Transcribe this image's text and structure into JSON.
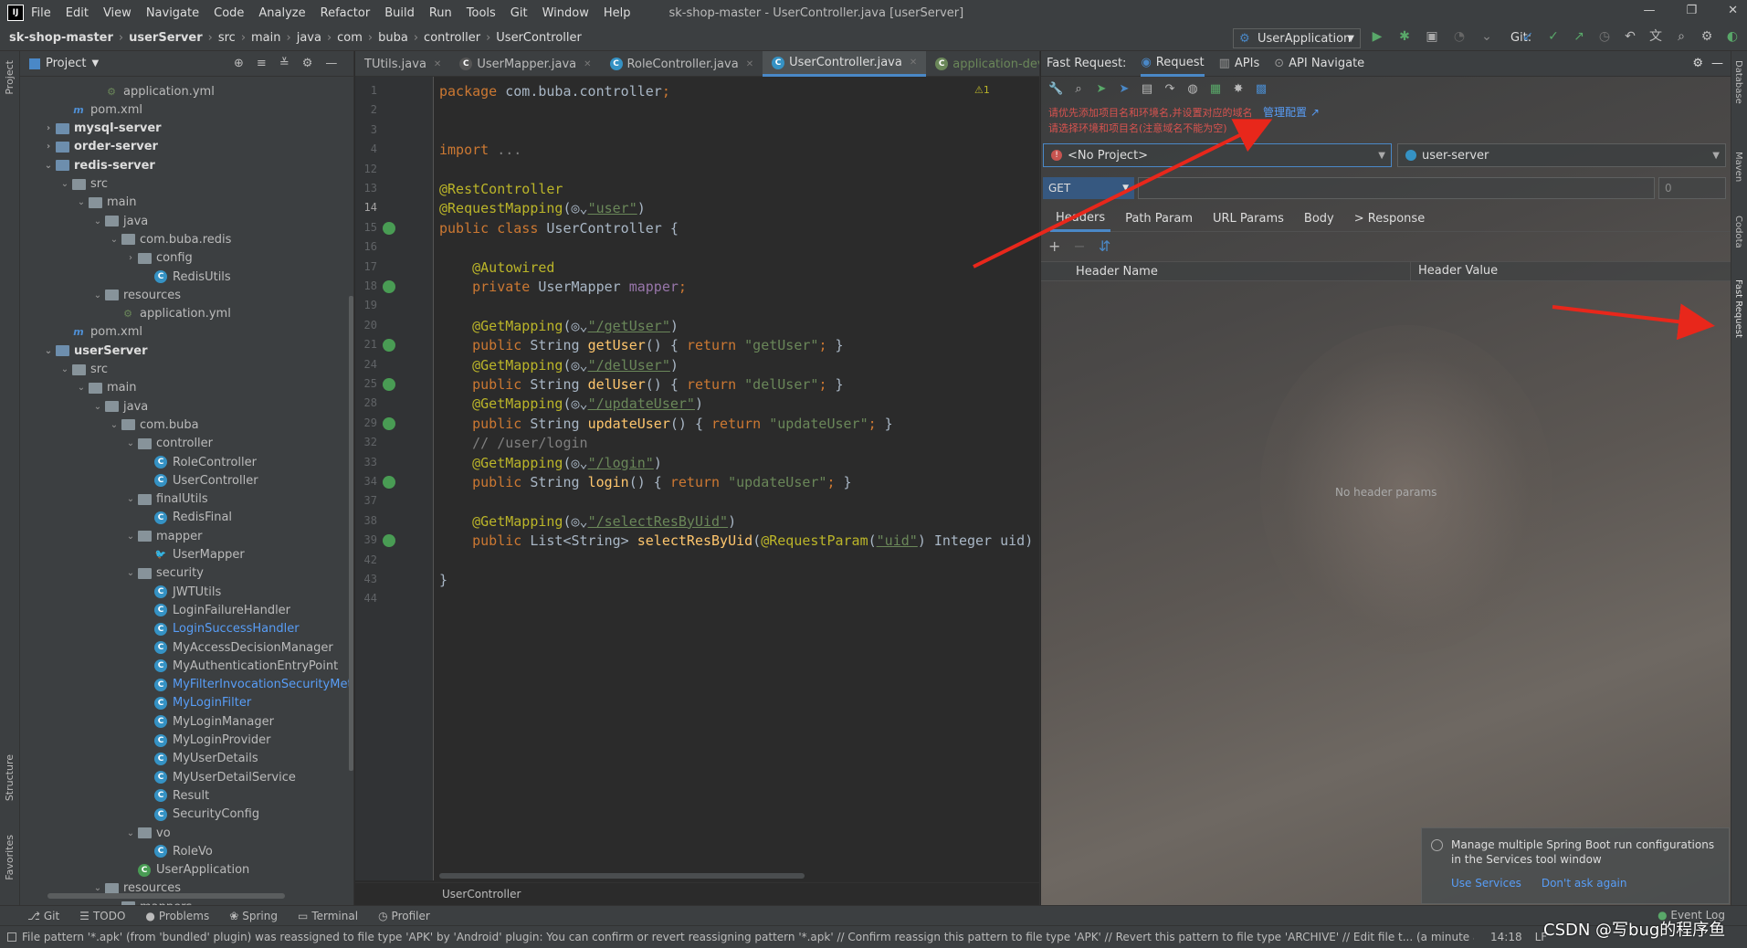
{
  "menu": {
    "items": [
      "File",
      "Edit",
      "View",
      "Navigate",
      "Code",
      "Analyze",
      "Refactor",
      "Build",
      "Run",
      "Tools",
      "Git",
      "Window",
      "Help"
    ],
    "window_title": "sk-shop-master - UserController.java [userServer]"
  },
  "breadcrumb": [
    "sk-shop-master",
    "userServer",
    "src",
    "main",
    "java",
    "com",
    "buba",
    "controller",
    "UserController"
  ],
  "run_config": "UserApplication",
  "git_label": "Git:",
  "project_panel": {
    "title": "Project",
    "tree": [
      {
        "label": "application.yml",
        "type": "yml",
        "depth": 4
      },
      {
        "label": "pom.xml",
        "type": "maven",
        "depth": 2
      },
      {
        "label": "mysql-server",
        "type": "module",
        "depth": 1,
        "arrow": "›",
        "bold": true
      },
      {
        "label": "order-server",
        "type": "module",
        "depth": 1,
        "arrow": "›",
        "bold": true
      },
      {
        "label": "redis-server",
        "type": "module",
        "depth": 1,
        "arrow": "⌄",
        "bold": true
      },
      {
        "label": "src",
        "type": "folder",
        "depth": 2,
        "arrow": "⌄"
      },
      {
        "label": "main",
        "type": "folder",
        "depth": 3,
        "arrow": "⌄"
      },
      {
        "label": "java",
        "type": "folder",
        "depth": 4,
        "arrow": "⌄"
      },
      {
        "label": "com.buba.redis",
        "type": "folder",
        "depth": 5,
        "arrow": "⌄"
      },
      {
        "label": "config",
        "type": "folder",
        "depth": 6,
        "arrow": "›"
      },
      {
        "label": "RedisUtils",
        "type": "class",
        "depth": 7
      },
      {
        "label": "resources",
        "type": "folder",
        "depth": 4,
        "arrow": "⌄"
      },
      {
        "label": "application.yml",
        "type": "yml",
        "depth": 5
      },
      {
        "label": "pom.xml",
        "type": "maven",
        "depth": 2
      },
      {
        "label": "userServer",
        "type": "module",
        "depth": 1,
        "arrow": "⌄",
        "bold": true
      },
      {
        "label": "src",
        "type": "folder",
        "depth": 2,
        "arrow": "⌄"
      },
      {
        "label": "main",
        "type": "folder",
        "depth": 3,
        "arrow": "⌄"
      },
      {
        "label": "java",
        "type": "folder",
        "depth": 4,
        "arrow": "⌄"
      },
      {
        "label": "com.buba",
        "type": "folder",
        "depth": 5,
        "arrow": "⌄"
      },
      {
        "label": "controller",
        "type": "folder",
        "depth": 6,
        "arrow": "⌄"
      },
      {
        "label": "RoleController",
        "type": "class",
        "depth": 7
      },
      {
        "label": "UserController",
        "type": "class",
        "depth": 7
      },
      {
        "label": "finalUtils",
        "type": "folder",
        "depth": 6,
        "arrow": "⌄"
      },
      {
        "label": "RedisFinal",
        "type": "class",
        "depth": 7
      },
      {
        "label": "mapper",
        "type": "folder",
        "depth": 6,
        "arrow": "⌄"
      },
      {
        "label": "UserMapper",
        "type": "mapper",
        "depth": 7
      },
      {
        "label": "security",
        "type": "folder",
        "depth": 6,
        "arrow": "⌄"
      },
      {
        "label": "JWTUtils",
        "type": "class",
        "depth": 7
      },
      {
        "label": "LoginFailureHandler",
        "type": "class",
        "depth": 7
      },
      {
        "label": "LoginSuccessHandler",
        "type": "class",
        "depth": 7,
        "blue": true
      },
      {
        "label": "MyAccessDecisionManager",
        "type": "class",
        "depth": 7
      },
      {
        "label": "MyAuthenticationEntryPoint",
        "type": "class",
        "depth": 7
      },
      {
        "label": "MyFilterInvocationSecurityMeta",
        "type": "class",
        "depth": 7,
        "blue": true
      },
      {
        "label": "MyLoginFilter",
        "type": "class",
        "depth": 7,
        "blue": true
      },
      {
        "label": "MyLoginManager",
        "type": "class",
        "depth": 7
      },
      {
        "label": "MyLoginProvider",
        "type": "class",
        "depth": 7
      },
      {
        "label": "MyUserDetails",
        "type": "class",
        "depth": 7
      },
      {
        "label": "MyUserDetailService",
        "type": "class",
        "depth": 7
      },
      {
        "label": "Result",
        "type": "class",
        "depth": 7
      },
      {
        "label": "SecurityConfig",
        "type": "class",
        "depth": 7
      },
      {
        "label": "vo",
        "type": "folder",
        "depth": 6,
        "arrow": "⌄"
      },
      {
        "label": "RoleVo",
        "type": "class",
        "depth": 7
      },
      {
        "label": "UserApplication",
        "type": "app",
        "depth": 6
      },
      {
        "label": "resources",
        "type": "folder",
        "depth": 4,
        "arrow": "⌄"
      },
      {
        "label": "mappers",
        "type": "folder",
        "depth": 5,
        "arrow": "⌄"
      }
    ]
  },
  "editor": {
    "tabs": [
      {
        "label": "TUtils.java",
        "active": false
      },
      {
        "label": "UserMapper.java",
        "active": false
      },
      {
        "label": "RoleController.java",
        "active": false
      },
      {
        "label": "UserController.java",
        "active": true
      },
      {
        "label": "application-dev.yml",
        "active": false
      }
    ],
    "warning_count": "⚠1",
    "line_numbers": [
      "1",
      "2",
      "3",
      "4",
      "12",
      "13",
      "14",
      "15",
      "16",
      "17",
      "18",
      "19",
      "20",
      "21",
      "24",
      "25",
      "28",
      "29",
      "32",
      "33",
      "34",
      "37",
      "38",
      "39",
      "42",
      "43",
      "44"
    ],
    "lines": [
      [
        [
          "kw",
          "package "
        ],
        [
          "",
          "com.buba.controller"
        ],
        [
          "kw",
          ";"
        ]
      ],
      [],
      [],
      [
        [
          "kw",
          "import "
        ],
        [
          "cmt",
          "..."
        ]
      ],
      [],
      [
        [
          "ann",
          "@RestController"
        ]
      ],
      [
        [
          "ann",
          "@RequestMapping"
        ],
        [
          "",
          "(◎⌄"
        ],
        [
          "strl",
          "\"user\""
        ],
        [
          "",
          ")"
        ]
      ],
      [
        [
          "kw",
          "public class "
        ],
        [
          "",
          "UserController {"
        ]
      ],
      [],
      [
        [
          "ann",
          "    @Autowired"
        ]
      ],
      [
        [
          "kw",
          "    private "
        ],
        [
          "",
          "UserMapper "
        ],
        [
          "fld",
          "mapper"
        ],
        [
          "kw",
          ";"
        ]
      ],
      [],
      [
        [
          "ann",
          "    @GetMapping"
        ],
        [
          "",
          "(◎⌄"
        ],
        [
          "strl",
          "\"/getUser\""
        ],
        [
          "",
          ")"
        ]
      ],
      [
        [
          "kw",
          "    public "
        ],
        [
          "",
          "String "
        ],
        [
          "fn",
          "getUser"
        ],
        [
          "",
          "() { "
        ],
        [
          "kw",
          "return "
        ],
        [
          "str",
          "\"getUser\""
        ],
        [
          "kw",
          ";"
        ],
        [
          "",
          " }"
        ]
      ],
      [
        [
          "ann",
          "    @GetMapping"
        ],
        [
          "",
          "(◎⌄"
        ],
        [
          "strl",
          "\"/delUser\""
        ],
        [
          "",
          ")"
        ]
      ],
      [
        [
          "kw",
          "    public "
        ],
        [
          "",
          "String "
        ],
        [
          "fn",
          "delUser"
        ],
        [
          "",
          "() { "
        ],
        [
          "kw",
          "return "
        ],
        [
          "str",
          "\"delUser\""
        ],
        [
          "kw",
          ";"
        ],
        [
          "",
          " }"
        ]
      ],
      [
        [
          "ann",
          "    @GetMapping"
        ],
        [
          "",
          "(◎⌄"
        ],
        [
          "strl",
          "\"/updateUser\""
        ],
        [
          "",
          ")"
        ]
      ],
      [
        [
          "kw",
          "    public "
        ],
        [
          "",
          "String "
        ],
        [
          "fn",
          "updateUser"
        ],
        [
          "",
          "() { "
        ],
        [
          "kw",
          "return "
        ],
        [
          "str",
          "\"updateUser\""
        ],
        [
          "kw",
          ";"
        ],
        [
          "",
          " }"
        ]
      ],
      [
        [
          "cmt",
          "    // /user/login"
        ]
      ],
      [
        [
          "ann",
          "    @GetMapping"
        ],
        [
          "",
          "(◎⌄"
        ],
        [
          "strl",
          "\"/login\""
        ],
        [
          "",
          ")"
        ]
      ],
      [
        [
          "kw",
          "    public "
        ],
        [
          "",
          "String "
        ],
        [
          "fn",
          "login"
        ],
        [
          "",
          "() { "
        ],
        [
          "kw",
          "return "
        ],
        [
          "str",
          "\"updateUser\""
        ],
        [
          "kw",
          ";"
        ],
        [
          "",
          " }"
        ]
      ],
      [],
      [
        [
          "ann",
          "    @GetMapping"
        ],
        [
          "",
          "(◎⌄"
        ],
        [
          "strl",
          "\"/selectResByUid\""
        ],
        [
          "",
          ")"
        ]
      ],
      [
        [
          "kw",
          "    public "
        ],
        [
          "",
          "List<String> "
        ],
        [
          "fn",
          "selectResByUid"
        ],
        [
          "",
          "("
        ],
        [
          "ann",
          "@RequestParam"
        ],
        [
          "",
          "("
        ],
        [
          "strl",
          "\"uid\""
        ],
        [
          "",
          ") Integer uid)"
        ]
      ],
      [],
      [
        [
          "",
          "}"
        ]
      ],
      []
    ],
    "status_breadcrumb": "UserController"
  },
  "fast_request": {
    "label": "Fast Request:",
    "tabs": [
      {
        "label": "Request",
        "active": true
      },
      {
        "label": "APIs",
        "active": false
      },
      {
        "label": "API Navigate",
        "active": false
      }
    ],
    "warning_1": "请优先添加项目名和环境名,并设置对应的域名",
    "manage_link": "管理配置 ↗",
    "warning_2": "请选择环境和项目名(注意域名不能为空)",
    "project_select": "<No Project>",
    "env_select": "user-server",
    "method": "GET",
    "port_placeholder": "0",
    "sub_tabs": [
      {
        "label": "Headers",
        "active": true
      },
      {
        "label": "Path Param",
        "active": false
      },
      {
        "label": "URL Params",
        "active": false
      },
      {
        "label": "Body",
        "active": false
      },
      {
        "label": "> Response",
        "active": false
      }
    ],
    "header_name_col": "Header Name",
    "header_value_col": "Header Value",
    "empty_text": "No header params"
  },
  "notification": {
    "text": "Manage multiple Spring Boot run configurations in the Services tool window",
    "link_1": "Use Services",
    "link_2": "Don't ask again"
  },
  "left_tool_labels": {
    "project": "Project",
    "structure": "Structure",
    "favorites": "Favorites"
  },
  "right_tool_labels": [
    "Database",
    "Maven",
    "Codota",
    "Fast Request"
  ],
  "bottom_tools": [
    "Git",
    "TODO",
    "Problems",
    "Spring",
    "Terminal",
    "Profiler"
  ],
  "event_log": "Event Log",
  "status_bar": {
    "message": "File pattern '*.apk' (from 'bundled' plugin) was reassigned to file type 'APK' by 'Android' plugin: You can confirm or revert reassigning pattern '*.apk' // Confirm reassign this pattern to file type 'APK' // Revert this pattern to file type 'ARCHIVE' // Edit file t... (a minute ago)",
    "position": "14:18",
    "line_sep": "LF"
  },
  "watermark": "CSDN @写bug的程序鱼",
  "colors": {
    "accent": "#4a88c7",
    "bg": "#2b2b2b",
    "panel": "#3c3f41",
    "arrow": "#e8271b"
  }
}
